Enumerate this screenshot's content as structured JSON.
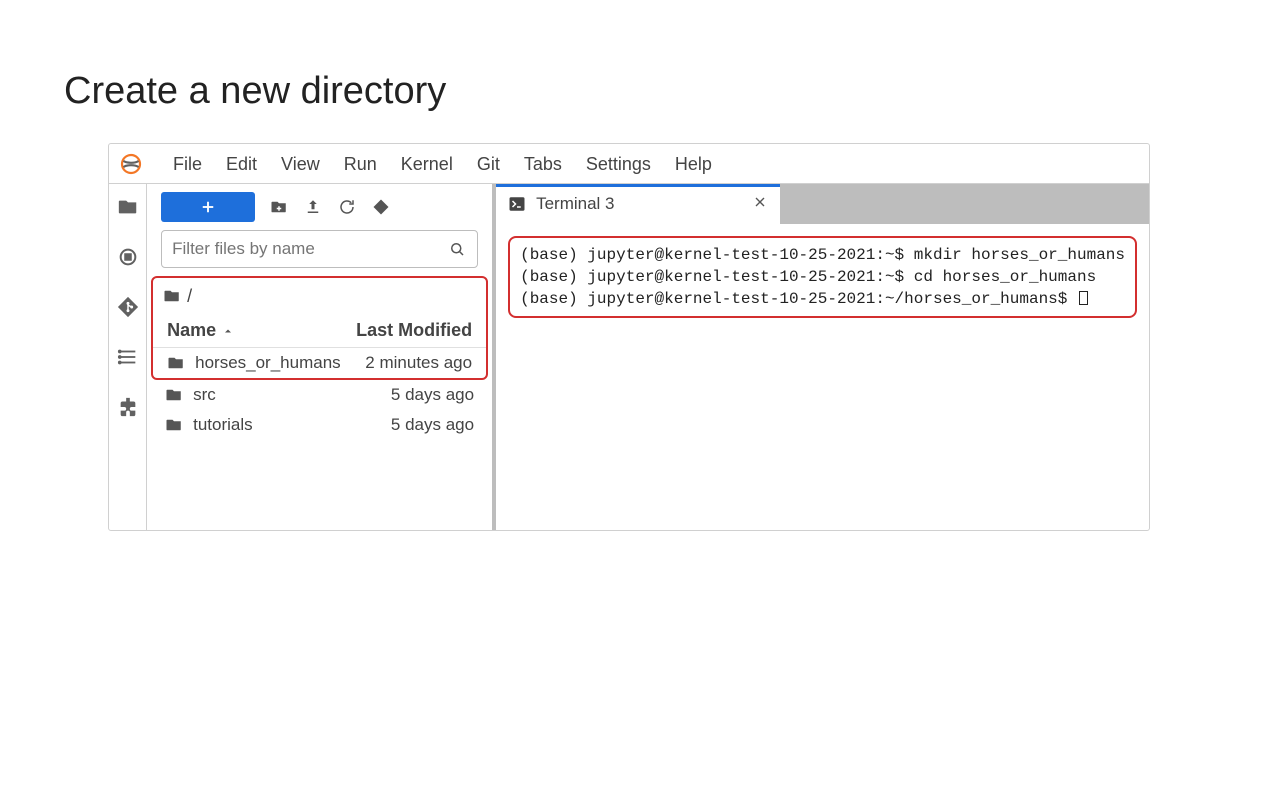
{
  "page": {
    "title": "Create a new directory"
  },
  "menubar": {
    "items": [
      "File",
      "Edit",
      "View",
      "Run",
      "Kernel",
      "Git",
      "Tabs",
      "Settings",
      "Help"
    ]
  },
  "filebrowser": {
    "filter_placeholder": "Filter files by name",
    "breadcrumb": "/",
    "columns": {
      "name": "Name",
      "modified": "Last Modified"
    },
    "rows": [
      {
        "name": "horses_or_humans",
        "modified": "2 minutes ago",
        "highlighted": true
      },
      {
        "name": "src",
        "modified": "5 days ago"
      },
      {
        "name": "tutorials",
        "modified": "5 days ago"
      }
    ]
  },
  "tab": {
    "label": "Terminal 3"
  },
  "terminal": {
    "lines": [
      "(base) jupyter@kernel-test-10-25-2021:~$ mkdir horses_or_humans",
      "(base) jupyter@kernel-test-10-25-2021:~$ cd horses_or_humans",
      "(base) jupyter@kernel-test-10-25-2021:~/horses_or_humans$ "
    ]
  }
}
